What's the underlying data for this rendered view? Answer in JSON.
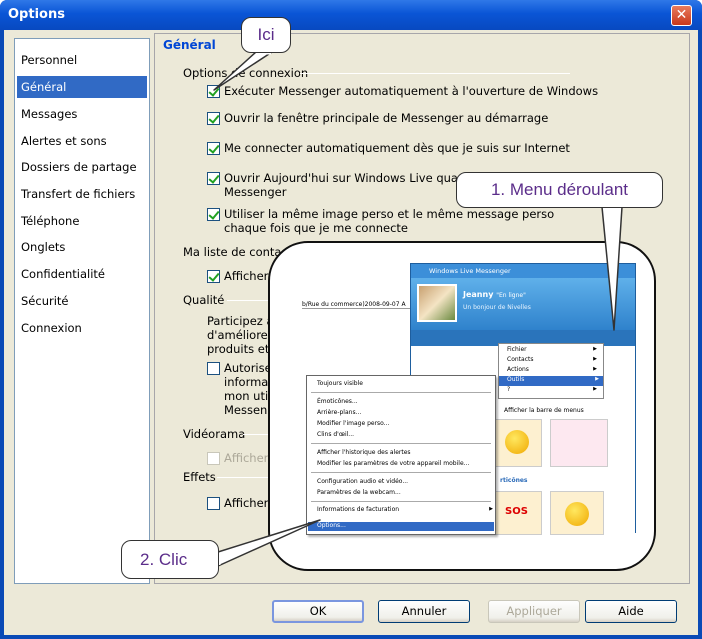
{
  "window": {
    "title": "Options",
    "close_glyph": "✕"
  },
  "sidebar": {
    "items": [
      {
        "label": "Personnel"
      },
      {
        "label": "Général"
      },
      {
        "label": "Messages"
      },
      {
        "label": "Alertes et sons"
      },
      {
        "label": "Dossiers de partage"
      },
      {
        "label": "Transfert de fichiers"
      },
      {
        "label": "Téléphone"
      },
      {
        "label": "Onglets"
      },
      {
        "label": "Confidentialité"
      },
      {
        "label": "Sécurité"
      },
      {
        "label": "Connexion"
      }
    ],
    "selected_index": 1
  },
  "panel": {
    "title": "Général",
    "groups": {
      "connexion": "Options de connexion",
      "contacts": "Ma liste de contacts",
      "qualite": "Qualité",
      "videorama": "Vidéorama",
      "effets": "Effets"
    },
    "checkboxes": [
      {
        "label": "Exécuter Messenger automatiquement à l'ouverture de Windows",
        "checked": true
      },
      {
        "label": "Ouvrir la fenêtre principale de Messenger au démarrage",
        "checked": true
      },
      {
        "label": "Me connecter automatiquement dès que je suis sur Internet",
        "checked": true
      },
      {
        "label_line1": "Ouvrir Aujourd'hui sur Windows Live quand j",
        "label_line2": "Messenger",
        "checked": true
      },
      {
        "label_line1": "Utiliser la même image perso et le même message perso",
        "label_line2": "chaque fois que je me connecte",
        "checked": true
      },
      {
        "label": "Afficher l'i",
        "checked": true
      },
      {
        "label_line1": "Autoriser",
        "label_line2": "informati",
        "label_line3": "mon utilis",
        "label_line4": "Messeng",
        "checked": false
      },
      {
        "label": "Afficher l",
        "checked": false,
        "disabled": true
      },
      {
        "label": "Afficher l",
        "checked": false
      }
    ],
    "qualite_text": [
      "Participez au",
      "d'améliorer l",
      "produits et s"
    ]
  },
  "buttons": {
    "ok": "OK",
    "cancel": "Annuler",
    "apply": "Appliquer",
    "help": "Aide"
  },
  "inset": {
    "browser_url": "b/Rue du commerce)2008-09-07 A",
    "wlm_title": "Windows Live Messenger",
    "wlm_name": "Jeanny",
    "wlm_status": "\"En ligne\"",
    "wlm_subtitle": "Un bonjour de Nivelles",
    "menu_items": [
      "Fichier",
      "Contacts",
      "Actions",
      "Outils",
      "?"
    ],
    "menu_highlight": "Outils",
    "show_menubar": "Afficher la barre de menus",
    "context_items": [
      "Toujours visible",
      "Émoticônes...",
      "Arrière-plans...",
      "Modifier l'image perso...",
      "Clins d'œil...",
      "Afficher l'historique des alertes",
      "Modifier les paramètres de votre appareil mobile...",
      "Configuration audio et vidéo...",
      "Paramètres de la webcam...",
      "Informations de facturation",
      "Options..."
    ],
    "emoticons_label": "rticônes",
    "sos_text": "SOS"
  },
  "callouts": {
    "ici": "Ici",
    "menu": "1. Menu déroulant",
    "clic": "2. Clic"
  },
  "colors": {
    "titlebar": "#0a55d6",
    "selection": "#316ac5",
    "panel_title": "#0046d5",
    "callout_text": "#5b2d8a"
  }
}
